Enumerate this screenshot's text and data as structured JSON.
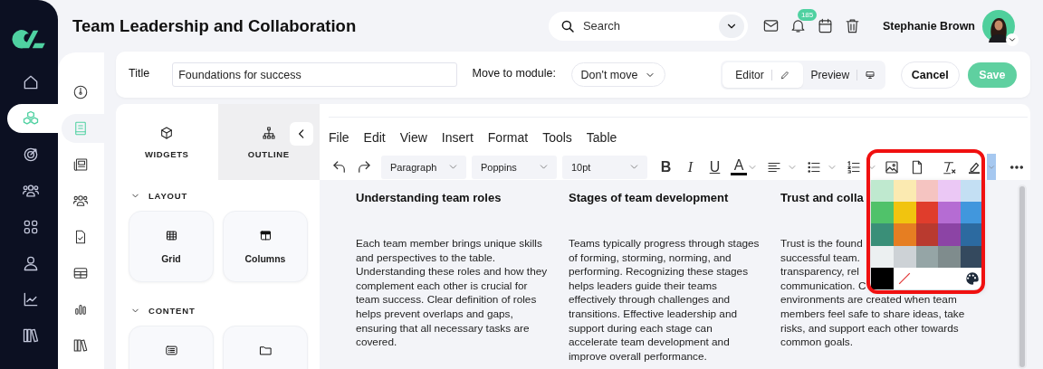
{
  "sidebar": {
    "items": [
      {
        "kind": "home",
        "selected": false
      },
      {
        "kind": "modules",
        "selected": true
      },
      {
        "kind": "target",
        "selected": false
      },
      {
        "kind": "people",
        "selected": false
      },
      {
        "kind": "grid",
        "selected": false
      },
      {
        "kind": "person",
        "selected": false
      },
      {
        "kind": "chart",
        "selected": false
      },
      {
        "kind": "library",
        "selected": false
      }
    ]
  },
  "subnav": {
    "items": [
      {
        "kind": "gauge",
        "selected": false
      },
      {
        "kind": "book",
        "selected": true
      },
      {
        "kind": "newspaper",
        "selected": false
      },
      {
        "kind": "people",
        "selected": false
      },
      {
        "kind": "doc-check",
        "selected": false
      },
      {
        "kind": "table",
        "selected": false
      },
      {
        "kind": "bar-chart",
        "selected": false
      },
      {
        "kind": "library",
        "selected": false
      }
    ]
  },
  "header": {
    "title": "Team Leadership and Collaboration",
    "search": {
      "placeholder": "Search"
    },
    "notifications": {
      "badge": "185"
    },
    "user": {
      "name": "Stephanie Brown"
    }
  },
  "lesson_form": {
    "title_label": "Title",
    "title_value": "Foundations for success",
    "move_label": "Move to module:",
    "move_value": "Don't move",
    "view_modes": [
      {
        "kind": "editor",
        "label": "Editor",
        "selected": true
      },
      {
        "kind": "preview",
        "label": "Preview",
        "selected": false
      }
    ],
    "cancel": "Cancel",
    "save": "Save"
  },
  "widgets_panel": {
    "tabs": [
      {
        "kind": "widgets",
        "label": "WIDGETS",
        "selected": true
      },
      {
        "kind": "outline",
        "label": "OUTLINE",
        "selected": false
      }
    ],
    "sections": [
      {
        "label": "LAYOUT",
        "expanded": true,
        "widgets": [
          {
            "kind": "grid",
            "label": "Grid"
          },
          {
            "kind": "columns",
            "label": "Columns"
          }
        ]
      },
      {
        "label": "CONTENT",
        "expanded": true,
        "widgets": [
          {
            "kind": "list"
          },
          {
            "kind": "folder"
          }
        ]
      }
    ]
  },
  "editor": {
    "menu": [
      "File",
      "Edit",
      "View",
      "Insert",
      "Format",
      "Tools",
      "Table"
    ],
    "toolbar": [
      {
        "kind": "undo"
      },
      {
        "kind": "redo"
      },
      {
        "kind": "select",
        "value": "Paragraph"
      },
      {
        "kind": "select",
        "value": "Poppins"
      },
      {
        "kind": "select",
        "value": "10pt"
      },
      {
        "kind": "bold",
        "label": "B"
      },
      {
        "kind": "italic",
        "label": "I"
      },
      {
        "kind": "underline",
        "label": "U"
      },
      {
        "kind": "text-color",
        "label": "A",
        "dropdown": true
      },
      {
        "kind": "align",
        "dropdown": true
      },
      {
        "kind": "bullets",
        "dropdown": true
      },
      {
        "kind": "numbered",
        "dropdown": true
      },
      {
        "kind": "image"
      },
      {
        "kind": "document"
      },
      {
        "kind": "clear-format"
      },
      {
        "kind": "highlight",
        "open": true
      },
      {
        "kind": "more"
      }
    ],
    "color_picker": {
      "swatches": [
        {
          "kind": "swatch",
          "color": "#bfe9cf"
        },
        {
          "kind": "swatch",
          "color": "#fbeab1"
        },
        {
          "kind": "swatch",
          "color": "#f5c4c1"
        },
        {
          "kind": "swatch",
          "color": "#ebc8f5"
        },
        {
          "kind": "swatch",
          "color": "#c3dff3"
        },
        {
          "kind": "swatch",
          "color": "#50c26a"
        },
        {
          "kind": "swatch",
          "color": "#f1c40f"
        },
        {
          "kind": "swatch",
          "color": "#e03d2c"
        },
        {
          "kind": "swatch",
          "color": "#b56cd3"
        },
        {
          "kind": "swatch",
          "color": "#4197dd"
        },
        {
          "kind": "swatch",
          "color": "#3a8f78"
        },
        {
          "kind": "swatch",
          "color": "#e67e22"
        },
        {
          "kind": "swatch",
          "color": "#b93a2f"
        },
        {
          "kind": "swatch",
          "color": "#8c44a5"
        },
        {
          "kind": "swatch",
          "color": "#2c6aa0"
        },
        {
          "kind": "swatch",
          "color": "#ecf0f1"
        },
        {
          "kind": "swatch",
          "color": "#cdd2d6"
        },
        {
          "kind": "swatch",
          "color": "#95a5a6"
        },
        {
          "kind": "swatch",
          "color": "#7f8c8d"
        },
        {
          "kind": "swatch",
          "color": "#34495e"
        },
        {
          "kind": "swatch",
          "color": "#000000"
        },
        {
          "kind": "remove"
        },
        {
          "kind": "empty"
        },
        {
          "kind": "empty"
        },
        {
          "kind": "custom"
        }
      ]
    },
    "columns": [
      {
        "heading": "Understanding team roles",
        "body": "Each team member brings unique skills and perspectives to the table. Understanding these roles and how they complement each other is crucial for team success. Clear definition of roles helps prevent overlaps and gaps, ensuring that all necessary tasks are covered."
      },
      {
        "heading": "Stages of team development",
        "body": "Teams typically progress through stages of forming, storming, norming, and performing. Recognizing these stages helps leaders guide their teams effectively through challenges and transitions. Effective leadership and support during each stage can accelerate team development and improve overall performance."
      },
      {
        "heading": "Trust and colla",
        "lines": [
          "Trust is the found",
          "successful team.",
          "transparency, rel",
          "communication. C",
          "environments are created when team",
          "members feel safe to share ideas, take",
          "risks, and support each other towards",
          "common goals."
        ]
      }
    ]
  }
}
